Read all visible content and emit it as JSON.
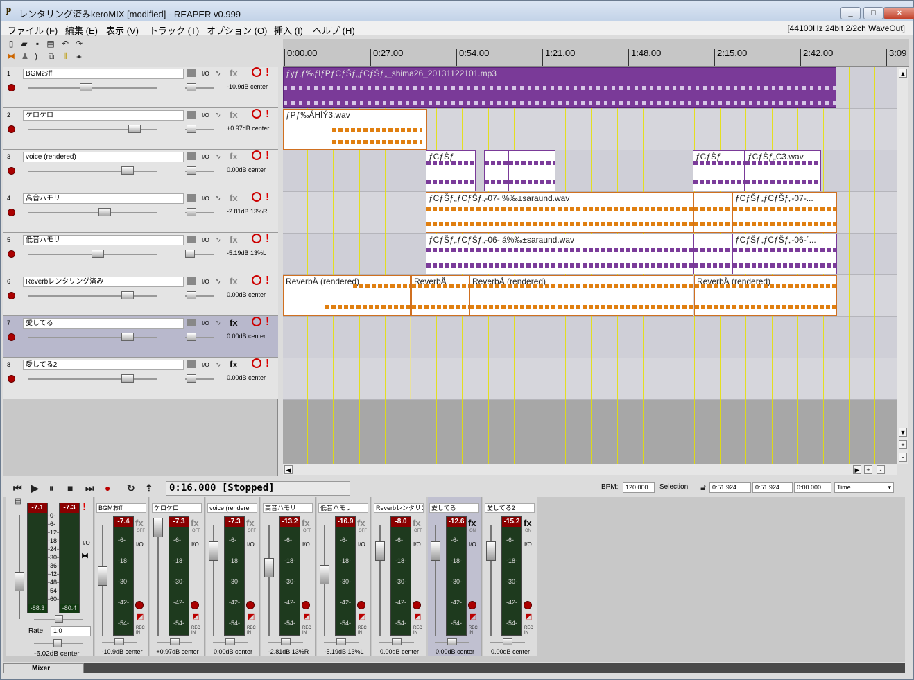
{
  "window": {
    "title": "レンタリング済みkeroMIX [modified] - REAPER v0.999",
    "controls": [
      "_",
      "□",
      "×"
    ]
  },
  "menu": [
    "ファイル (F)",
    "編集 (E)",
    "表示 (V)",
    "トラック (T)",
    "オプション (O)",
    "挿入 (I)",
    "ヘルプ (H)"
  ],
  "status": "[44100Hz 24bit 2/2ch WaveOut]",
  "ruler": [
    "0:00.00",
    "0:27.00",
    "0:54.00",
    "1:21.00",
    "1:48.00",
    "2:15.00",
    "2:42.00",
    "3:09"
  ],
  "tracks": [
    {
      "num": "1",
      "name": "BGMおff",
      "vol": "-10.9dB center",
      "fx": "fx",
      "fx_on": false
    },
    {
      "num": "2",
      "name": "ケロケロ",
      "vol": "+0.97dB center",
      "fx": "fx",
      "fx_on": false
    },
    {
      "num": "3",
      "name": "voice (rendered)",
      "vol": "0.00dB center",
      "fx": "fx",
      "fx_on": false
    },
    {
      "num": "4",
      "name": "高音ハモリ",
      "vol": "-2.81dB 13%R",
      "fx": "fx",
      "fx_on": false
    },
    {
      "num": "5",
      "name": "低音ハモリ",
      "vol": "-5.19dB 13%L",
      "fx": "fx",
      "fx_on": false
    },
    {
      "num": "6",
      "name": "Reverbレンタリング済み",
      "vol": "0.00dB center",
      "fx": "fx",
      "fx_on": false
    },
    {
      "num": "7",
      "name": "愛してる",
      "vol": "0.00dB center",
      "fx": "fx",
      "fx_on": true
    },
    {
      "num": "8",
      "name": "愛してる2",
      "vol": "0.00dB center",
      "fx": "fx",
      "fx_on": true
    }
  ],
  "items": {
    "t1": "ƒyƒ‚ƒ‰ƒlƒPƒCƒŠƒ„ƒCƒŠƒ„_shima26_20131122101.mp3",
    "t2": "ƒPƒ‰ÁHÍÝ3.wav",
    "t3a": "ƒCƒŠƒ",
    "t3b": "ƒCƒŠƒ",
    "t3c": "ƒCƒŠƒ„C3.wav",
    "t4a": "ƒCƒŠƒ„ƒCƒŠƒ„-07- %‰±saraund.wav",
    "t4b": "ƒCƒŠƒ„ƒCƒŠƒ„-07-...",
    "t5a": "ƒCƒŠƒ„ƒCƒŠƒ„-06- á%‰±saraund.wav",
    "t5b": "ƒCƒŠƒ„ƒCƒŠƒ„-06-´...",
    "t6a": "ReverbÅ (rendered)",
    "t6b": "ReverbÅ",
    "t6c": "ReverbÅ (rendered)",
    "t6d": "ReverbÅ (rendered)"
  },
  "transport": {
    "time": "0:16.000 [Stopped]",
    "bpm_label": "BPM:",
    "bpm": "120.000",
    "selection_label": "Selection:",
    "sel_start": "0:51.924",
    "sel_end": "0:51.924",
    "sel_len": "0:00.000",
    "mode": "Time"
  },
  "master": {
    "peak_l": "-7.1",
    "peak_r": "-7.3",
    "low_l": "-88.3",
    "low_r": "-80.4",
    "scale": [
      "-0-",
      "-6-",
      "-12-",
      "-18-",
      "-24-",
      "-30-",
      "-36-",
      "-42-",
      "-48-",
      "-54-",
      "-60-"
    ],
    "rate_label": "Rate:",
    "rate": "1.0",
    "info": "-6.02dB center"
  },
  "mixer": [
    {
      "name": "BGMおff",
      "peak": "-7.4",
      "fx": "fx",
      "fxstate": "OFF",
      "info": "-10.9dB center",
      "fx_on": false
    },
    {
      "name": "ケロケロ",
      "peak": "-7.3",
      "fx": "fx",
      "fxstate": "OFF",
      "info": "+0.97dB center",
      "fx_on": false
    },
    {
      "name": "voice (rendere",
      "peak": "-7.3",
      "fx": "fx",
      "fxstate": "OFF",
      "info": "0.00dB center",
      "fx_on": false
    },
    {
      "name": "高音ハモリ",
      "peak": "-13.2",
      "fx": "fx",
      "fxstate": "OFF",
      "info": "-2.81dB 13%R",
      "fx_on": false
    },
    {
      "name": "低音ハモリ",
      "peak": "-16.9",
      "fx": "fx",
      "fxstate": "OFF",
      "info": "-5.19dB 13%L",
      "fx_on": false
    },
    {
      "name": "Reverbレンタリン",
      "peak": "-8.0",
      "fx": "fx",
      "fxstate": "OFF",
      "info": "0.00dB center",
      "fx_on": false
    },
    {
      "name": "愛してる",
      "peak": "-12.6",
      "fx": "fx",
      "fxstate": "ON",
      "info": "0.00dB center",
      "fx_on": true
    },
    {
      "name": "愛してる2",
      "peak": "-15.2",
      "fx": "fx",
      "fxstate": "ON",
      "info": "0.00dB center",
      "fx_on": true
    }
  ],
  "strip_scale": [
    "-6-",
    "-18-",
    "-30-",
    "-42-",
    "-54-"
  ],
  "labels": {
    "io": "I/O",
    "rec_in": "REC IN"
  },
  "mixer_tab": "Mixer"
}
